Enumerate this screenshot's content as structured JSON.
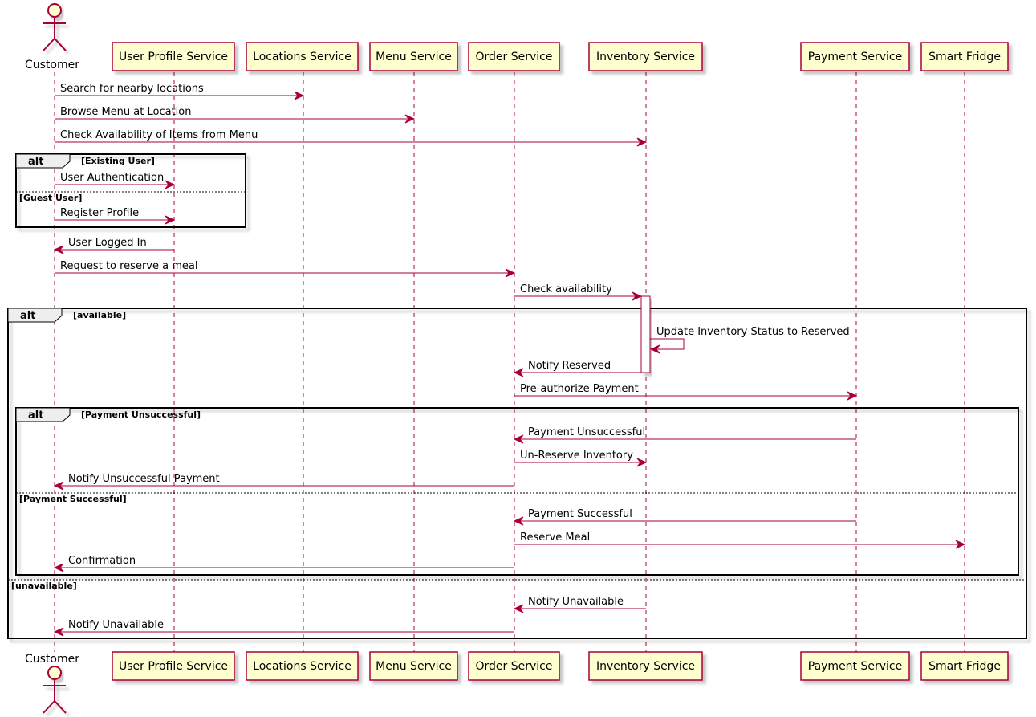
{
  "colors": {
    "line": "#A80036",
    "participant_fill": "#FEFECE",
    "frame": "#000000",
    "shadow": "#C8C8C8"
  },
  "participants": [
    {
      "id": "customer",
      "label": "Customer",
      "kind": "actor"
    },
    {
      "id": "user_profile",
      "label": "User Profile Service",
      "kind": "participant"
    },
    {
      "id": "locations",
      "label": "Locations Service",
      "kind": "participant"
    },
    {
      "id": "menu",
      "label": "Menu Service",
      "kind": "participant"
    },
    {
      "id": "order",
      "label": "Order Service",
      "kind": "participant"
    },
    {
      "id": "inventory",
      "label": "Inventory Service",
      "kind": "participant"
    },
    {
      "id": "payment",
      "label": "Payment Service",
      "kind": "participant"
    },
    {
      "id": "fridge",
      "label": "Smart Fridge",
      "kind": "participant"
    }
  ],
  "messages": [
    {
      "from": "customer",
      "to": "locations",
      "label": "Search for nearby locations"
    },
    {
      "from": "customer",
      "to": "menu",
      "label": "Browse Menu at Location"
    },
    {
      "from": "customer",
      "to": "inventory",
      "label": "Check Availability of Items from Menu"
    },
    {
      "from": "customer",
      "to": "user_profile",
      "label": "User Authentication"
    },
    {
      "from": "customer",
      "to": "user_profile",
      "label": "Register Profile"
    },
    {
      "from": "user_profile",
      "to": "customer",
      "label": "User Logged In"
    },
    {
      "from": "customer",
      "to": "order",
      "label": "Request to reserve a meal"
    },
    {
      "from": "order",
      "to": "inventory",
      "label": "Check availability"
    },
    {
      "from": "inventory",
      "to": "inventory",
      "label": "Update Inventory Status to Reserved"
    },
    {
      "from": "inventory",
      "to": "order",
      "label": "Notify Reserved"
    },
    {
      "from": "order",
      "to": "payment",
      "label": "Pre-authorize Payment"
    },
    {
      "from": "payment",
      "to": "order",
      "label": "Payment Unsuccessful"
    },
    {
      "from": "order",
      "to": "inventory",
      "label": "Un-Reserve Inventory"
    },
    {
      "from": "order",
      "to": "customer",
      "label": "Notify Unsuccessful Payment"
    },
    {
      "from": "payment",
      "to": "order",
      "label": "Payment Successful"
    },
    {
      "from": "order",
      "to": "fridge",
      "label": "Reserve Meal"
    },
    {
      "from": "order",
      "to": "customer",
      "label": "Confirmation"
    },
    {
      "from": "inventory",
      "to": "order",
      "label": "Notify Unavailable"
    },
    {
      "from": "order",
      "to": "customer",
      "label": "Notify Unavailable"
    }
  ],
  "frames": [
    {
      "keyword": "alt",
      "guard": "[Existing User]",
      "else_guard": "[Guest User]"
    },
    {
      "keyword": "alt",
      "guard": "[available]",
      "else_guard": "[unavailable]"
    },
    {
      "keyword": "alt",
      "guard": "[Payment Unsuccessful]",
      "else_guard": "[Payment Successful]"
    }
  ]
}
